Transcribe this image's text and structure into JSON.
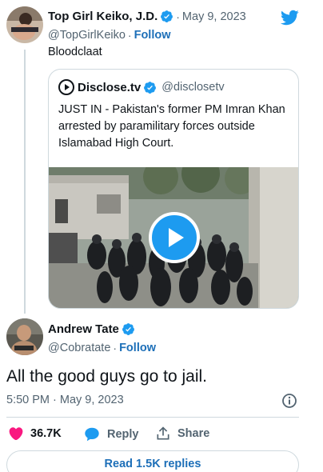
{
  "quoting_tweet": {
    "name": "Top Girl Keiko, J.D.",
    "separator": "·",
    "date": "May 9, 2023",
    "handle": "@TopGirlKeiko",
    "follow_label": "Follow",
    "text": "Bloodclaat"
  },
  "quoted_tweet": {
    "name": "Disclose.tv",
    "handle": "@disclosetv",
    "text": "JUST IN - Pakistan's former PM Imran Khan arrested by paramilitary forces outside Islamabad High Court."
  },
  "main_tweet": {
    "name": "Andrew Tate",
    "handle": "@Cobratate",
    "separator": "·",
    "follow_label": "Follow",
    "text": "All the good guys go to jail.",
    "timestamp": "5:50 PM · May 9, 2023"
  },
  "actions": {
    "likes": "36.7K",
    "reply_label": "Reply",
    "share_label": "Share"
  },
  "footer": {
    "read_replies_label": "Read 1.5K replies"
  },
  "icons": {
    "brand": "twitter-bird-icon",
    "verified": "verified-badge-icon",
    "play": "play-icon",
    "info": "info-icon",
    "like": "heart-icon",
    "reply": "reply-bubble-icon",
    "share": "share-icon"
  },
  "colors": {
    "brand_blue": "#1d9bf0",
    "link_blue": "#1d6fb8",
    "like_red": "#f91880",
    "secondary_text": "#536471",
    "border": "#cfd9de"
  }
}
